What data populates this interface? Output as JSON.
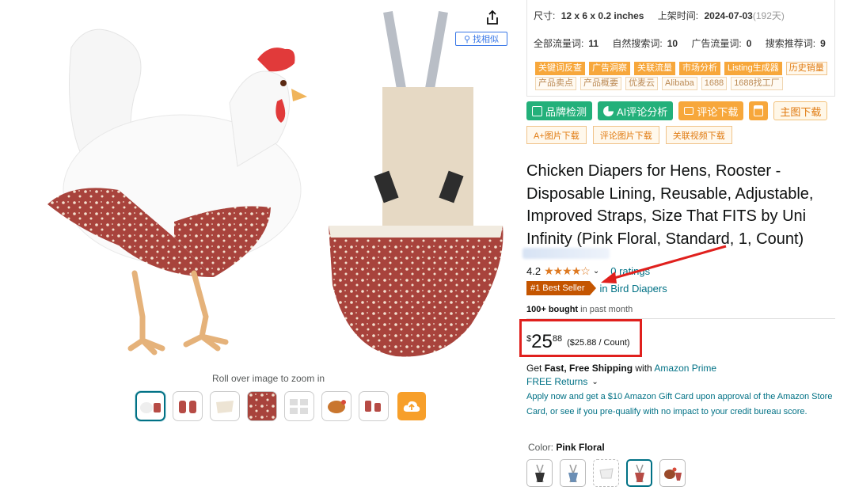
{
  "gallery": {
    "find_similar": "找相似",
    "zoom_hint": "Roll over image to zoom in",
    "share_icon": "share-icon",
    "upload_icon": "cloud-upload-icon"
  },
  "plugin": {
    "size_label": "尺寸:",
    "size_value": "12 x 6 x 0.2 inches",
    "listed_label": "上架时间:",
    "listed_value": "2024-07-03",
    "listed_days": "(192天)",
    "traffic": [
      {
        "label": "全部流量词:",
        "value": "11"
      },
      {
        "label": "自然搜索词:",
        "value": "10"
      },
      {
        "label": "广告流量词:",
        "value": "0"
      },
      {
        "label": "搜索推荐词:",
        "value": "9"
      }
    ],
    "tags_row1": [
      "关键词反查",
      "广告洞察",
      "关联流量",
      "市场分析",
      "Listing生成器",
      "历史销量"
    ],
    "tags_row2": [
      "产品卖点",
      "产品概要",
      "优麦云",
      "Alibaba",
      "1688",
      "1688找工厂"
    ]
  },
  "tools": {
    "brand_check": "品牌检测",
    "ai_review": "AI评论分析",
    "review_download": "评论下载",
    "main_image_download": "主图下载",
    "aplus_download": "A+图片下载",
    "review_image_download": "评论图片下载",
    "video_download": "关联视频下载"
  },
  "product": {
    "title": "Chicken Diapers for Hens, Rooster - Disposable Lining, Reusable, Adjustable, Improved Straps, Size That FITS by Uni Infinity (Pink Floral, Standard, 1, Count)",
    "rating": "4.2",
    "rating_stars": 4.2,
    "ratings_text": "0 ratings",
    "best_seller_badge": "#1 Best Seller",
    "best_seller_category": "in Bird Diapers",
    "bought_bold": "100+ bought",
    "bought_rest": " in past month",
    "price_symbol": "$",
    "price_whole": "25",
    "price_fraction": "88",
    "price_per_unit": "($25.88 / Count)",
    "shipping_prefix": "Get ",
    "shipping_bold": "Fast, Free Shipping",
    "shipping_with": " with ",
    "shipping_link": "Amazon Prime",
    "returns": "FREE Returns",
    "promo": "Apply now and get a $10 Amazon Gift Card upon approval of the Amazon Store Card, or see if you pre-qualify with no impact to your credit bureau score.",
    "color_label": "Color: ",
    "color_value": "Pink Floral"
  },
  "colors": {
    "price_highlight": "#e0201d",
    "link": "#007185",
    "star": "#de7921",
    "best_seller": "#c45500",
    "plugin_green": "#23b07a",
    "plugin_orange": "#f7a73b"
  }
}
